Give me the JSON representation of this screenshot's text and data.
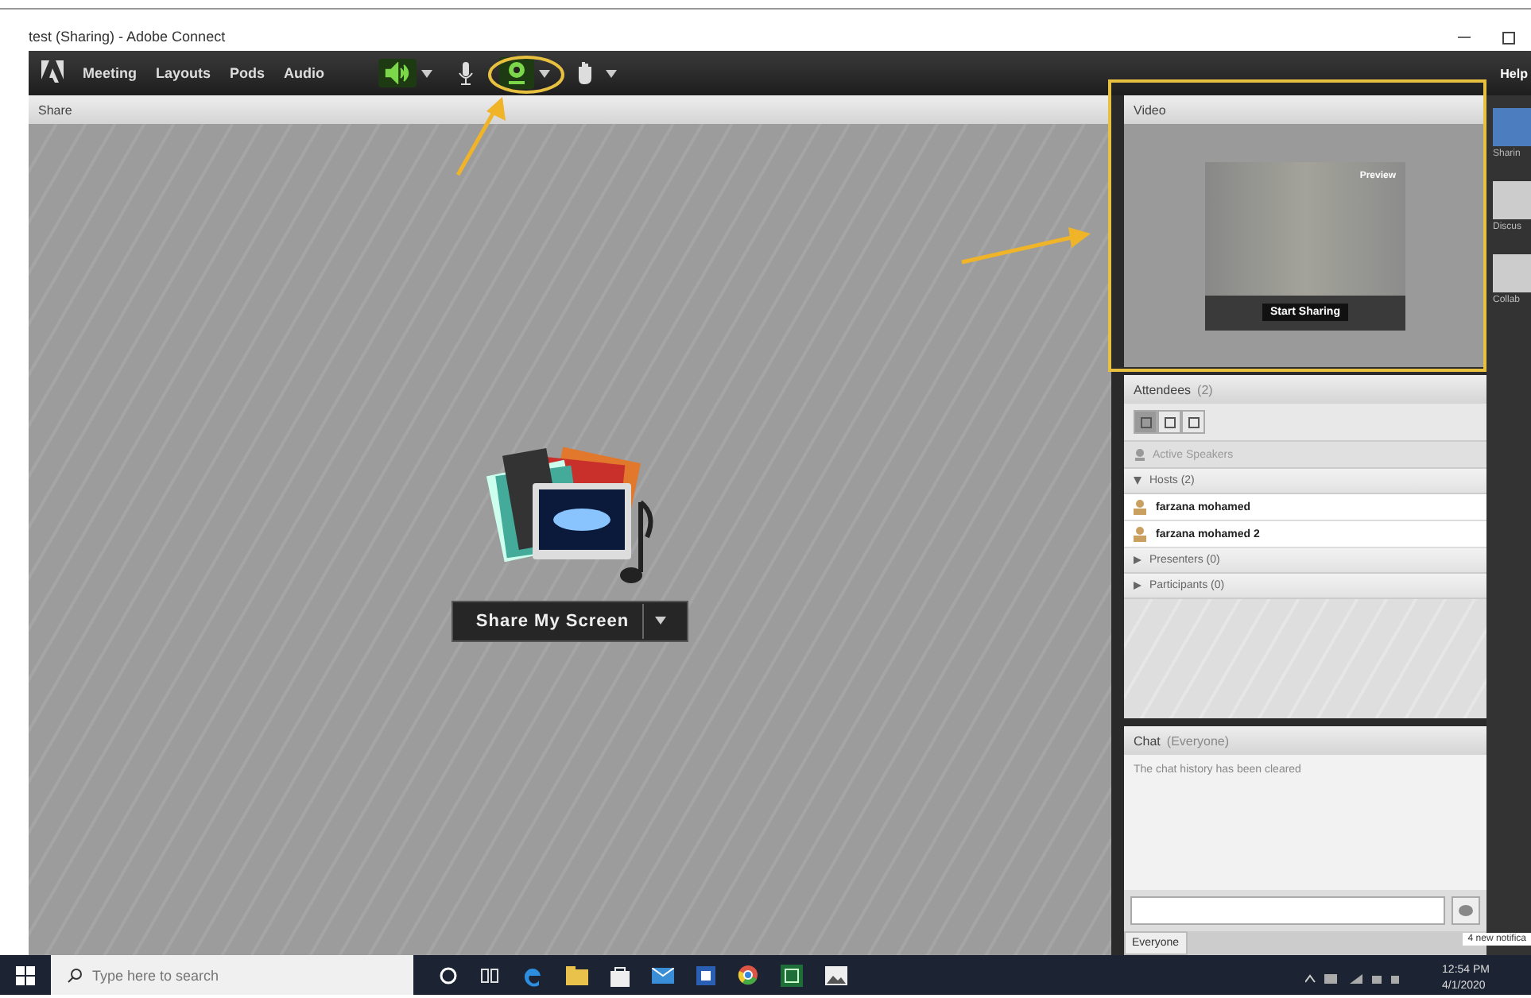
{
  "window": {
    "title": "test (Sharing) - Adobe Connect"
  },
  "menu": [
    "Meeting",
    "Layouts",
    "Pods",
    "Audio"
  ],
  "toolbar": [
    {
      "kind": "speaker",
      "on": true
    },
    {
      "kind": "mic",
      "on": false
    },
    {
      "kind": "webcam",
      "on": true
    },
    {
      "kind": "hand",
      "on": false
    }
  ],
  "help": "Help",
  "share_pod": {
    "title": "Share",
    "button": "Share My Screen"
  },
  "video_pod": {
    "title": "Video",
    "preview_badge": "Preview",
    "button": "Start Sharing"
  },
  "attendees_pod": {
    "title": "Attendees",
    "count": "(2)",
    "view_tabs": [
      {
        "selected": true
      },
      {
        "selected": false
      },
      {
        "selected": false
      }
    ],
    "active_speakers": "Active Speakers",
    "groups": [
      {
        "label": "Hosts (2)",
        "expanded": true,
        "children": [
          {
            "name": "farzana mohamed"
          },
          {
            "name": "farzana mohamed 2"
          }
        ]
      },
      {
        "label": "Presenters (0)",
        "expanded": false
      },
      {
        "label": "Participants (0)",
        "expanded": false
      }
    ]
  },
  "chat_pod": {
    "title": "Chat",
    "scope": "(Everyone)",
    "messages": [
      "The chat history has been cleared"
    ],
    "recipient_tab": "Everyone"
  },
  "layouts_strip": [
    "Sharin",
    "Discus",
    "Collab"
  ],
  "notification": "4 new notifica",
  "taskbar": {
    "search_placeholder": "Type here to search",
    "time": "12:54 PM",
    "date": "4/1/2020"
  }
}
